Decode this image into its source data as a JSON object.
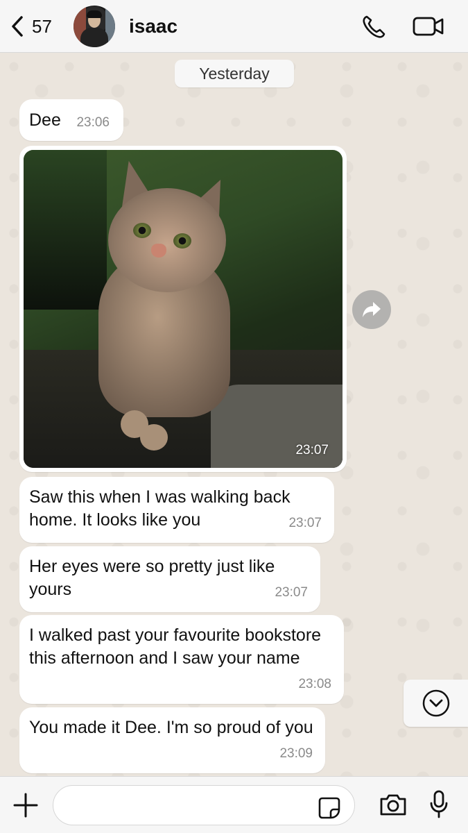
{
  "header": {
    "back_count": "57",
    "contact_name": "isaac"
  },
  "chat": {
    "date_chip": "Yesterday",
    "messages": [
      {
        "text": "Dee",
        "time": "23:06"
      },
      {
        "type": "image",
        "description": "cat",
        "time": "23:07"
      },
      {
        "text": "Saw this when I was walking back home. It looks like you",
        "time": "23:07"
      },
      {
        "text": "Her eyes were so pretty just like yours",
        "time": "23:07"
      },
      {
        "text": "I walked past your favourite bookstore this afternoon and I saw your name",
        "time": "23:08"
      },
      {
        "text": "You made it Dee. I'm so proud of you",
        "time": "23:09"
      }
    ]
  },
  "composer": {
    "value": "",
    "placeholder": ""
  },
  "icons": {
    "back": "chevron-left-icon",
    "call": "phone-icon",
    "video": "video-camera-icon",
    "forward": "forward-arrow-icon",
    "scroll_down": "chevron-down-circle-icon",
    "attach": "plus-icon",
    "sticker": "sticker-icon",
    "camera": "camera-icon",
    "mic": "microphone-icon"
  }
}
